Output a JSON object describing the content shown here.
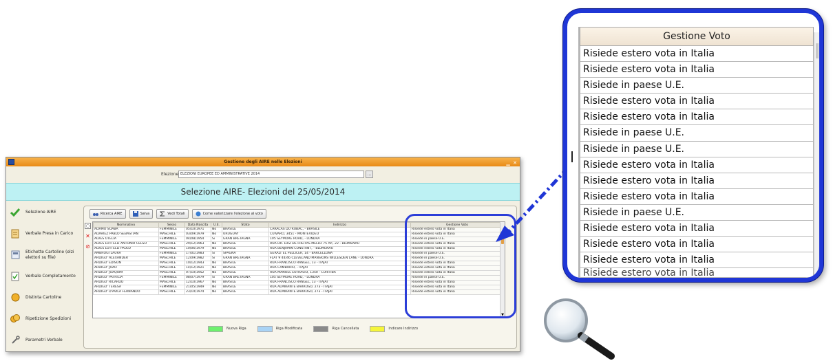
{
  "window": {
    "title": "Gestione degli AIRE nelle Elezioni",
    "controls": "▁ ✕"
  },
  "election": {
    "label": "Elezione",
    "value": "ELEZIONI EUROPEE ED AMMINISTRATIVE 2014",
    "picker": "…"
  },
  "banner": {
    "title": "Selezione AIRE- Elezioni del 25/05/2014"
  },
  "sidebar": {
    "items": [
      {
        "label": "Selezione AIRE",
        "icon": "checkmark-icon"
      },
      {
        "label": "Verbale Presa in Carico",
        "icon": "document-icon"
      },
      {
        "label": "Etichette Cartoline (elzi elettori su file)",
        "icon": "label-icon"
      },
      {
        "label": "Verbale Completamento",
        "icon": "check-document-icon"
      },
      {
        "label": "Distinta Cartoline",
        "icon": "coin-icon"
      },
      {
        "label": "Ripetizione Spedizioni",
        "icon": "coins-icon"
      },
      {
        "label": "Parametri Verbale",
        "icon": "tools-icon"
      }
    ]
  },
  "toolbar": {
    "search_label": "Ricerca AIRE",
    "save_label": "Salva",
    "totals_label": "Vedi Totali",
    "help_label": "Come valorizzare l'elezione al voto"
  },
  "grid": {
    "columns": [
      "Nominativo",
      "Sesso",
      "Data Nascita",
      "U.E.",
      "Stato",
      "Indirizzo",
      "Gestione Voto"
    ],
    "rows": [
      [
        "ADAMO SOABA",
        "FEMMINILE",
        "05/10/1971",
        "No",
        "BRASILE",
        "CARACAS DU RUBAC, - BRASILE",
        "Risiede estero vota in Italia"
      ],
      [
        "ALVAREZ PABLO SEBASTIAN",
        "MASCHILE",
        "03/09/1979",
        "No",
        "URUGUAY",
        "CUIVARO, 3451 - MONTEVIDEO",
        "Risiede estero vota in Italia"
      ],
      [
        "ALVES OTELIA",
        "FEMMINILE",
        "04/08/1954",
        "Si",
        "GRAN BRETAGNA",
        "105 SEYMORE ROAD, - LONDRA",
        "Risiede in paese U.E."
      ],
      [
        "ALVES LOTTELLI ANTONIO CELSO",
        "MASCHILE",
        "29/12/1963",
        "No",
        "BRASILE",
        "RUA DR. LUIZ DE FREITAS MELLO 75 AP., 22 - BLUMENAU",
        "Risiede estero vota in Italia"
      ],
      [
        "ALVES LOTTELLI PAULO",
        "MASCHILE",
        "10/06/1979",
        "No",
        "BRASILE",
        "RUA BENJAMIN CONSTANT, - BLUMENAU",
        "Risiede estero vota in Italia"
      ],
      [
        "AMBROGI LAURA",
        "FEMMINILE",
        "17/01/1983",
        "Si",
        "SPAGNA",
        "GERALT EL PELLICER, 14 - BARCELLONA",
        "Risiede in paese U.E."
      ],
      [
        "ARDIGO' ALEXANDER",
        "MASCHILE",
        "12/09/1982",
        "Si",
        "GRAN BRETAGNA",
        "FLAT 9 44/46 CLEVELAND MANSIONS WILLESDEN LANE - LONDRA",
        "Risiede in paese U.E."
      ],
      [
        "ARDIGO' EDISON",
        "MASCHILE",
        "10/12/1943",
        "No",
        "BRASILE",
        "RUA FRANCISCO RANGEL, 13 - ITAJAI",
        "Risiede estero vota in Italia"
      ],
      [
        "ARDIGO' JOAO",
        "MASCHILE",
        "14/12/1921",
        "No",
        "BRASILE",
        "RUA CAMBORIU, - ITAJAI",
        "Risiede estero vota in Italia"
      ],
      [
        "ARDIGO' JOAQUIM",
        "MASCHILE",
        "07/10/1952",
        "No",
        "BRASILE",
        "RUA MANOEL EUFRASIO, 1350 - CURITIBA",
        "Risiede estero vota in Italia"
      ],
      [
        "ARDIGO' PATRICIA",
        "FEMMINILE",
        "08/07/1979",
        "Si",
        "GRAN BRETAGNA",
        "105 SEYMORE ROAD, - LONDRA",
        "Risiede in paese U.E."
      ],
      [
        "ARDIGO' RICARDO",
        "MASCHILE",
        "12/10/1967",
        "No",
        "BRASILE",
        "RUA FRANCISCO RANGEL, 13 - ITAJAI",
        "Risiede estero vota in Italia"
      ],
      [
        "ARDIGO' TERESA",
        "FEMMINILE",
        "21/05/1949",
        "No",
        "BRASILE",
        "RUA ALMIRANTE BARROSO, 273 - ITAJAI",
        "Risiede estero vota in Italia"
      ],
      [
        "ARDIGO' D'AVILA FERNANDO",
        "MASCHILE",
        "23/10/1974",
        "No",
        "BRASILE",
        "RUA ALMIRANTE BARROSO, 273 - ITAJAI",
        "Risiede estero vota in Italia"
      ]
    ]
  },
  "legend": [
    {
      "label": "Nuova Riga",
      "color": "#6ef06e"
    },
    {
      "label": "Riga Modificata",
      "color": "#a9d3f5"
    },
    {
      "label": "Riga Cancellata",
      "color": "#8a8a8a"
    },
    {
      "label": "Indicare Indirizzo",
      "color": "#f5f53a"
    }
  ],
  "zoom": {
    "header": "Gestione Voto",
    "rows": [
      "Risiede estero vota in Italia",
      "Risiede estero vota in Italia",
      "Risiede in paese U.E.",
      "Risiede estero vota in Italia",
      "Risiede estero vota in Italia",
      "Risiede in paese U.E.",
      "Risiede in paese U.E.",
      "Risiede estero vota in Italia",
      "Risiede estero vota in Italia",
      "Risiede estero vota in Italia",
      "Risiede in paese U.E.",
      "Risiede estero vota in Italia",
      "Risiede estero vota in Italia",
      "Risiede estero vota in Italia",
      "Risiede estero vota in Italia"
    ]
  },
  "colors": {
    "accent_blue": "#1f36d6",
    "title_bar": "#e88a17",
    "banner": "#bdf1f3"
  }
}
